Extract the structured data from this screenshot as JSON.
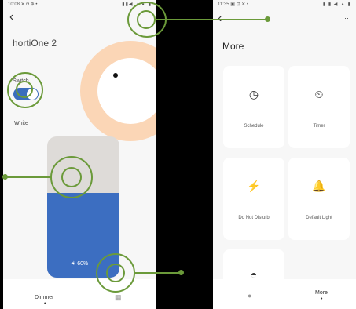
{
  "left_phone": {
    "status_time": "10:08 ✕ ◘ ⊕ •",
    "status_icons": "▮▮◀ ▲▲ ▮",
    "back_icon": "‹",
    "device_name": "hortiOne 2",
    "switch_label": "Switch",
    "switch_on": true,
    "white_label": "White",
    "brightness": "☀ 60%",
    "brightness_level": 0.6,
    "tab_dimmer": "Dimmer",
    "tab_dimmer_dot": "•",
    "tab_grid_icon": "▦",
    "colors": {
      "ring": "#fbd6b6",
      "accent": "#3c6ec1",
      "slider_bg": "#dedbd8"
    }
  },
  "right_phone": {
    "status_time": "11:35 ▣ ⊡ ✕ •",
    "status_icons": "▮ ▮ ◀ ▲ ▮",
    "back_icon": "‹",
    "more_menu_icon": "···",
    "title": "More",
    "cards": [
      {
        "icon": "◷",
        "label": "Schedule"
      },
      {
        "icon": "⏲",
        "label": "Timer"
      },
      {
        "icon": "⚡",
        "label": "Do Not Disturb"
      },
      {
        "icon": "🔔",
        "label": "Default Light"
      },
      {
        "icon": "◓",
        "label": ""
      }
    ],
    "tab_home_icon": "●",
    "tab_more": "More",
    "tab_more_dot": "•"
  },
  "annotation_color": "#6b9a3a"
}
